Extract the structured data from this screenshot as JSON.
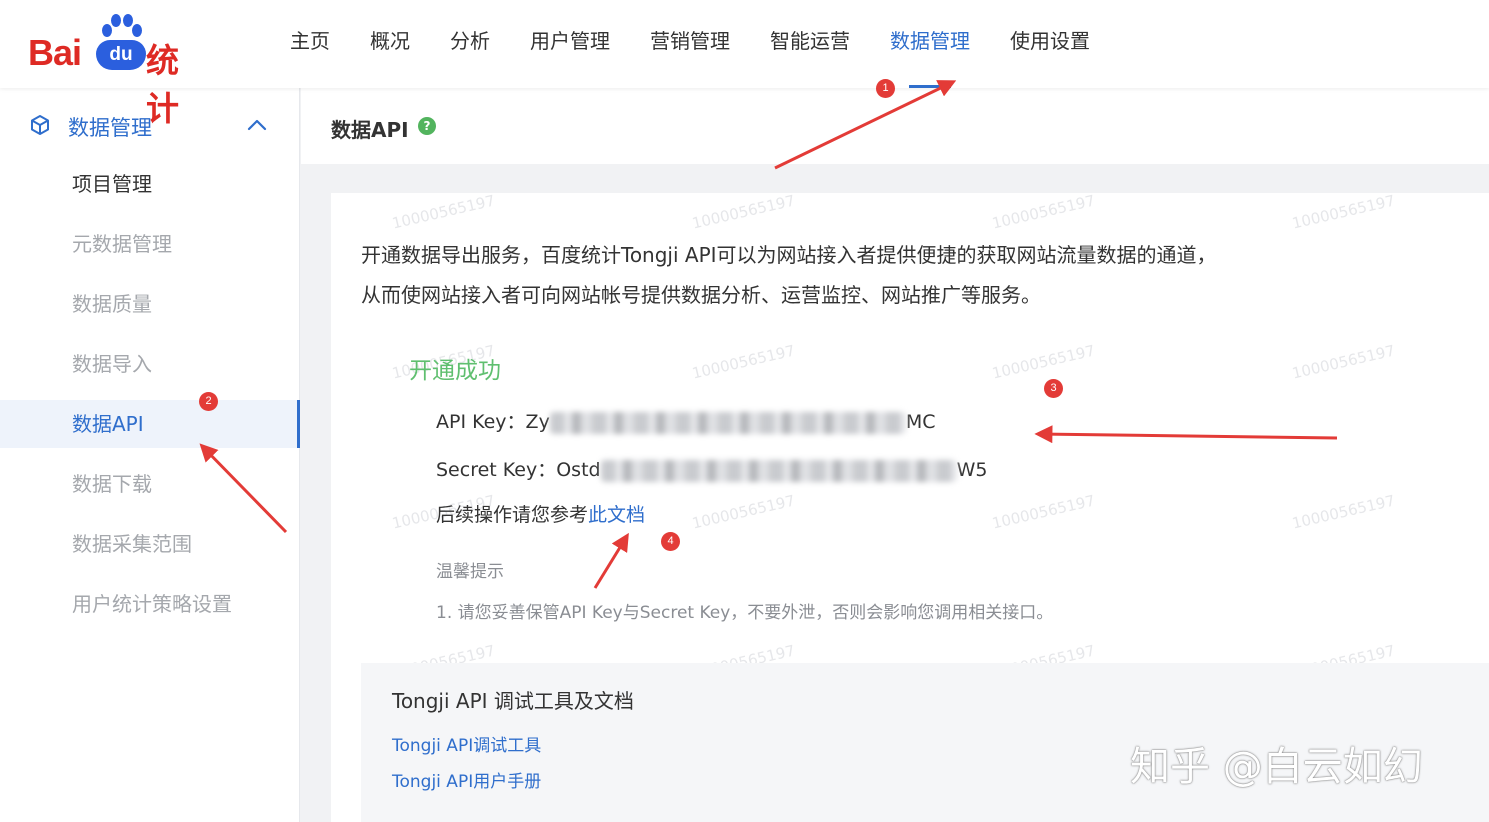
{
  "brand": {
    "logo_latin": "Bai",
    "logo_du": "du",
    "logo_cn": "统计"
  },
  "nav": {
    "items": [
      {
        "label": "主页"
      },
      {
        "label": "概况"
      },
      {
        "label": "分析"
      },
      {
        "label": "用户管理"
      },
      {
        "label": "营销管理"
      },
      {
        "label": "智能运营"
      },
      {
        "label": "数据管理",
        "active": true
      },
      {
        "label": "使用设置"
      }
    ]
  },
  "sidebar": {
    "section_label": "数据管理",
    "items": [
      {
        "label": "项目管理"
      },
      {
        "label": "元数据管理"
      },
      {
        "label": "数据质量"
      },
      {
        "label": "数据导入"
      },
      {
        "label": "数据API",
        "active": true
      },
      {
        "label": "数据下载"
      },
      {
        "label": "数据采集范围"
      },
      {
        "label": "用户统计策略设置"
      }
    ]
  },
  "content": {
    "title": "数据API",
    "help_glyph": "?",
    "intro_line1": "开通数据导出服务，百度统计Tongji API可以为网站接入者提供便捷的获取网站流量数据的通道，",
    "intro_line2": "从而使网站接入者可向网站帐号提供数据分析、运营监控、网站推广等服务。",
    "success": "开通成功",
    "api_key": {
      "label": "API Key：",
      "visible_start": "Zy",
      "visible_end": "MC"
    },
    "secret_key": {
      "label": "Secret Key：",
      "visible_start": "Ostd",
      "visible_end": "W5"
    },
    "followup_prefix": "后续操作请您参考",
    "followup_link": "此文档",
    "tip_title": "温馨提示",
    "tip_text": "1. 请您妥善保管API Key与Secret Key，不要外泄，否则会影响您调用相关接口。",
    "tools": {
      "title": "Tongji API 调试工具及文档",
      "link1": "Tongji API调试工具",
      "link2": "Tongji API用户手册"
    },
    "watermark": "10000565197"
  },
  "annotations": {
    "badges": [
      "1",
      "2",
      "3",
      "4"
    ]
  },
  "overlay_watermark": "知乎 @白云如幻",
  "colors": {
    "accent": "#2f6ecc",
    "success": "#5fbf6f",
    "brand_red": "#de2a24",
    "brand_blue": "#2b5fde",
    "annotation": "#e33b37"
  }
}
